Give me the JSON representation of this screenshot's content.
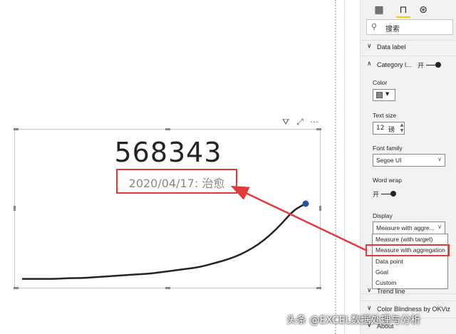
{
  "kpi": {
    "value": "568343",
    "label": "2020/04/17: 治愈"
  },
  "visual_header": {
    "filter_icon": "filter-icon",
    "focus_icon": "focus-mode-icon",
    "more_icon": "more-options-icon"
  },
  "pane": {
    "tabs": [
      {
        "icon": "fields-icon"
      },
      {
        "icon": "format-paint-roller-icon"
      },
      {
        "icon": "analytics-icon"
      }
    ],
    "search": {
      "placeholder": "搜索"
    },
    "sections": {
      "data_label": "Data label",
      "category_label": "Category l...",
      "trend_line": "Trend line",
      "color_blindness": "Color Blindness by OKViz",
      "about": "About"
    },
    "toggle_on_text": "开",
    "color": {
      "label": "Color",
      "swatch": "#8a8886"
    },
    "text_size": {
      "label": "Text size",
      "value": "12",
      "unit": "磅"
    },
    "font_family": {
      "label": "Font family",
      "value": "Segoe UI"
    },
    "word_wrap": {
      "label": "Word wrap",
      "toggle_text": "开"
    },
    "display": {
      "label": "Display",
      "selected": "Measure with aggre...",
      "options": [
        "Measure (with target)",
        "Measure with aggregation",
        "Data point",
        "Goal",
        "Custom"
      ]
    }
  },
  "chart_data": {
    "type": "line",
    "series": [
      {
        "values": [
          4,
          4,
          4,
          4,
          5,
          5,
          6,
          7,
          8,
          9,
          10,
          11,
          13,
          15,
          17,
          19,
          23,
          27,
          32,
          39,
          48,
          60,
          75,
          92,
          100
        ]
      }
    ]
  },
  "colors": {
    "highlight_red": "#e23a3a",
    "endpoint_blue": "#2b4fa8",
    "accent_yellow": "#f2c811"
  },
  "watermark": "头条 @EXCEL数据处理与分析"
}
